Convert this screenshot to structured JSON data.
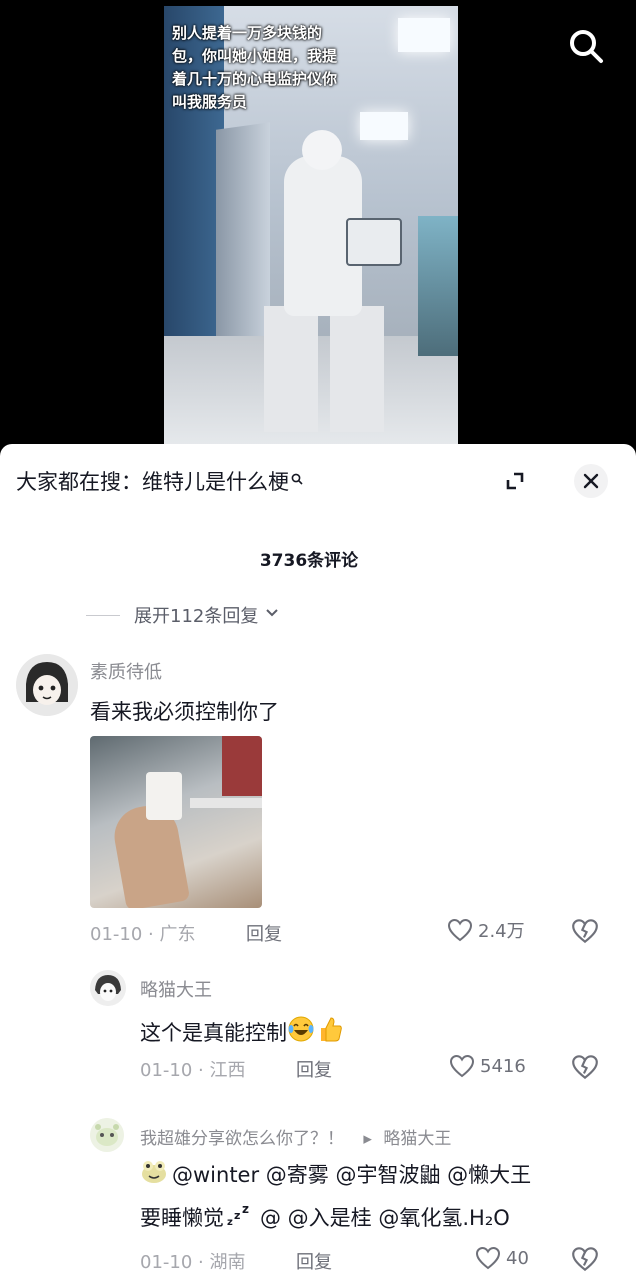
{
  "video": {
    "caption": "别人提着一万多块钱的包，你叫她小姐姐，我提着几十万的心电监护仪你叫我服务员",
    "search_icon": "search-icon"
  },
  "sheet": {
    "hot_search": "大家都在搜：维特儿是什么梗",
    "expand_icon": "expand-icon",
    "close_icon": "close-icon",
    "comment_count": "3736条评论",
    "expand_replies": "展开112条回复"
  },
  "comments": [
    {
      "username": "素质待低",
      "text": "看来我必须控制你了",
      "has_image": true,
      "date": "01-10",
      "location": "广东",
      "reply_label": "回复",
      "likes": "2.4万"
    }
  ],
  "replies": [
    {
      "username": "略猫大王",
      "text": "这个是真能控制",
      "emoji": [
        "laugh-cry-emoji",
        "thumbs-up-emoji"
      ],
      "date": "01-10",
      "location": "江西",
      "reply_label": "回复",
      "likes": "5416"
    },
    {
      "username": "我超雄分享欲怎么你了？！",
      "reply_to": "略猫大王",
      "line1": "@winter @寄雾 @宇智波鼬 @懒大王",
      "line2_prefix": "要睡懒觉",
      "line2_rest": "@ @入是桂 @氧化氢.H₂O",
      "date": "01-10",
      "location": "湖南",
      "reply_label": "回复",
      "likes": "40"
    }
  ],
  "meta_separator": " · "
}
